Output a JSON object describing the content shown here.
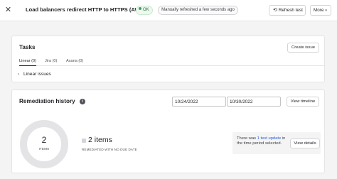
{
  "header": {
    "close_glyph": "✕",
    "title": "Load balancers redirect HTTP to HTTPS (AWS)",
    "status_label": "OK",
    "refresh_status": "Manually refreshed a few seconds ago",
    "refresh_label": "Refresh test",
    "refresh_icon_glyph": "⟲",
    "more_label": "More",
    "more_icon_glyph": "▾"
  },
  "tasks": {
    "title": "Tasks",
    "create_label": "Create issue",
    "tabs": [
      {
        "label": "Linear (0)",
        "active": true
      },
      {
        "label": "Jira (0)",
        "active": false
      },
      {
        "label": "Asana (0)",
        "active": false
      }
    ],
    "linear_row": {
      "chevron_glyph": "›",
      "label": "Linear issues"
    }
  },
  "remediation": {
    "title": "Remediation history",
    "info_glyph": "i",
    "date_from": "10/24/2022",
    "date_to": "10/30/2022",
    "timeline_label": "View timeline",
    "donut_count": "2",
    "donut_label": "ITEMS",
    "legend_count": "2 items",
    "legend_sub": "REMEDIATED WITH NO DUE DATE",
    "notice_prefix": "There was ",
    "notice_link": "1 test update",
    "notice_suffix": " in the time period selected.",
    "details_label": "View details"
  },
  "colors": {
    "accent_link": "#2a5bd7",
    "ok_green": "#3fa25a",
    "donut_ring": "#e4e4e7"
  }
}
